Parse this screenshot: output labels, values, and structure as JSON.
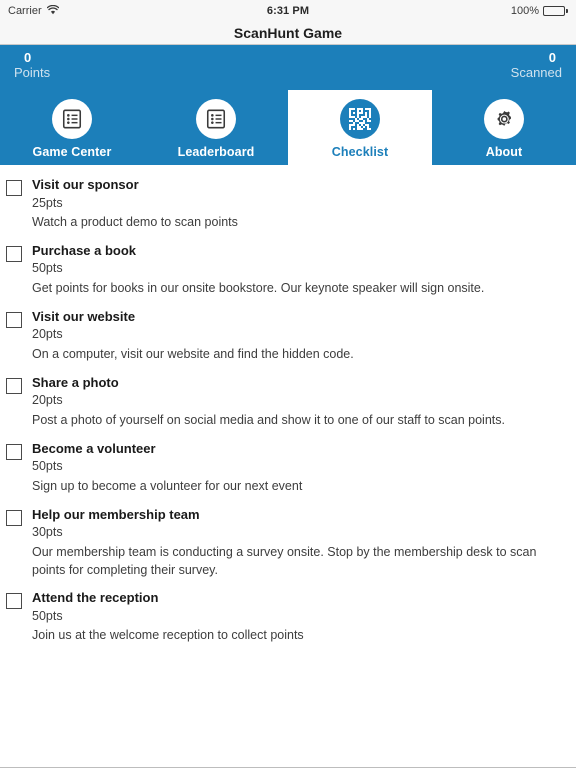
{
  "statusbar": {
    "carrier": "Carrier",
    "wifi_icon": "wifi-icon",
    "time": "6:31 PM",
    "battery_percent": "100%",
    "battery_icon": "battery-icon"
  },
  "navbar": {
    "title": "ScanHunt Game"
  },
  "colors": {
    "brand_blue": "#1c7fba",
    "header_label": "#cfe2ef",
    "active_tab_bg": "#ffffff"
  },
  "header": {
    "points": {
      "value": "0",
      "label": "Points"
    },
    "scanned": {
      "value": "0",
      "label": "Scanned"
    }
  },
  "tabs": [
    {
      "label": "Game Center",
      "icon": "list-icon",
      "active": false
    },
    {
      "label": "Leaderboard",
      "icon": "list-icon",
      "active": false
    },
    {
      "label": "Checklist",
      "icon": "qr-code-icon",
      "active": true
    },
    {
      "label": "About",
      "icon": "gear-icon",
      "active": false
    }
  ],
  "checklist": [
    {
      "title": "Visit our sponsor",
      "points": "25pts",
      "description": "Watch a product demo to scan points",
      "checked": false
    },
    {
      "title": "Purchase a book",
      "points": "50pts",
      "description": "Get points for books in our onsite bookstore. Our keynote speaker will sign onsite.",
      "checked": false
    },
    {
      "title": "Visit our website",
      "points": "20pts",
      "description": "On a computer, visit our website and find the hidden code.",
      "checked": false
    },
    {
      "title": "Share a photo",
      "points": "20pts",
      "description": "Post a photo of yourself on social media and show it to one of our staff to scan points.",
      "checked": false
    },
    {
      "title": "Become a volunteer",
      "points": "50pts",
      "description": "Sign up to become a volunteer for our next event",
      "checked": false
    },
    {
      "title": "Help our membership team",
      "points": "30pts",
      "description": "Our membership team is conducting a survey onsite. Stop by the membership desk to scan points for completing their survey.",
      "checked": false
    },
    {
      "title": "Attend the reception",
      "points": "50pts",
      "description": "Join us at the welcome reception to collect points",
      "checked": false
    }
  ]
}
